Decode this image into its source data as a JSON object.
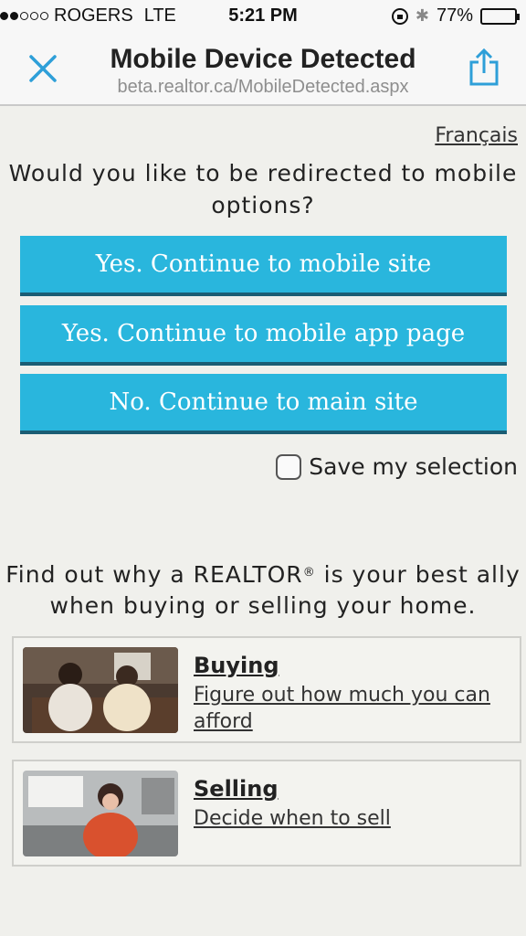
{
  "status_bar": {
    "carrier": "ROGERS",
    "network": "LTE",
    "time": "5:21 PM",
    "battery": "77%",
    "battery_level": 0.77,
    "signal_bars_filled": 2,
    "signal_bars_total": 5
  },
  "navbar": {
    "title": "Mobile Device Detected",
    "url": "beta.realtor.ca/MobileDetected.aspx",
    "accent_color": "#2e9fd8"
  },
  "language_link": "Français",
  "question": "Would you like to be redirected to mobile options?",
  "buttons": {
    "mobile_site": "Yes. Continue to mobile site",
    "mobile_app": "Yes. Continue to mobile app page",
    "main_site": "No. Continue to main site",
    "color": "#29b6dd"
  },
  "save_selection": {
    "label": "Save my selection",
    "checked": false
  },
  "promo": {
    "text_before": "Find out why a REALTOR",
    "registered_mark": "®",
    "text_after": " is your best ally when buying or selling your home."
  },
  "cards": [
    {
      "title": "Buying",
      "description": "Figure out how much you can afford",
      "thumbnail": "two-women-on-couch-photo"
    },
    {
      "title": "Selling",
      "description": "Decide when to sell",
      "thumbnail": "woman-in-kitchen-photo"
    }
  ]
}
